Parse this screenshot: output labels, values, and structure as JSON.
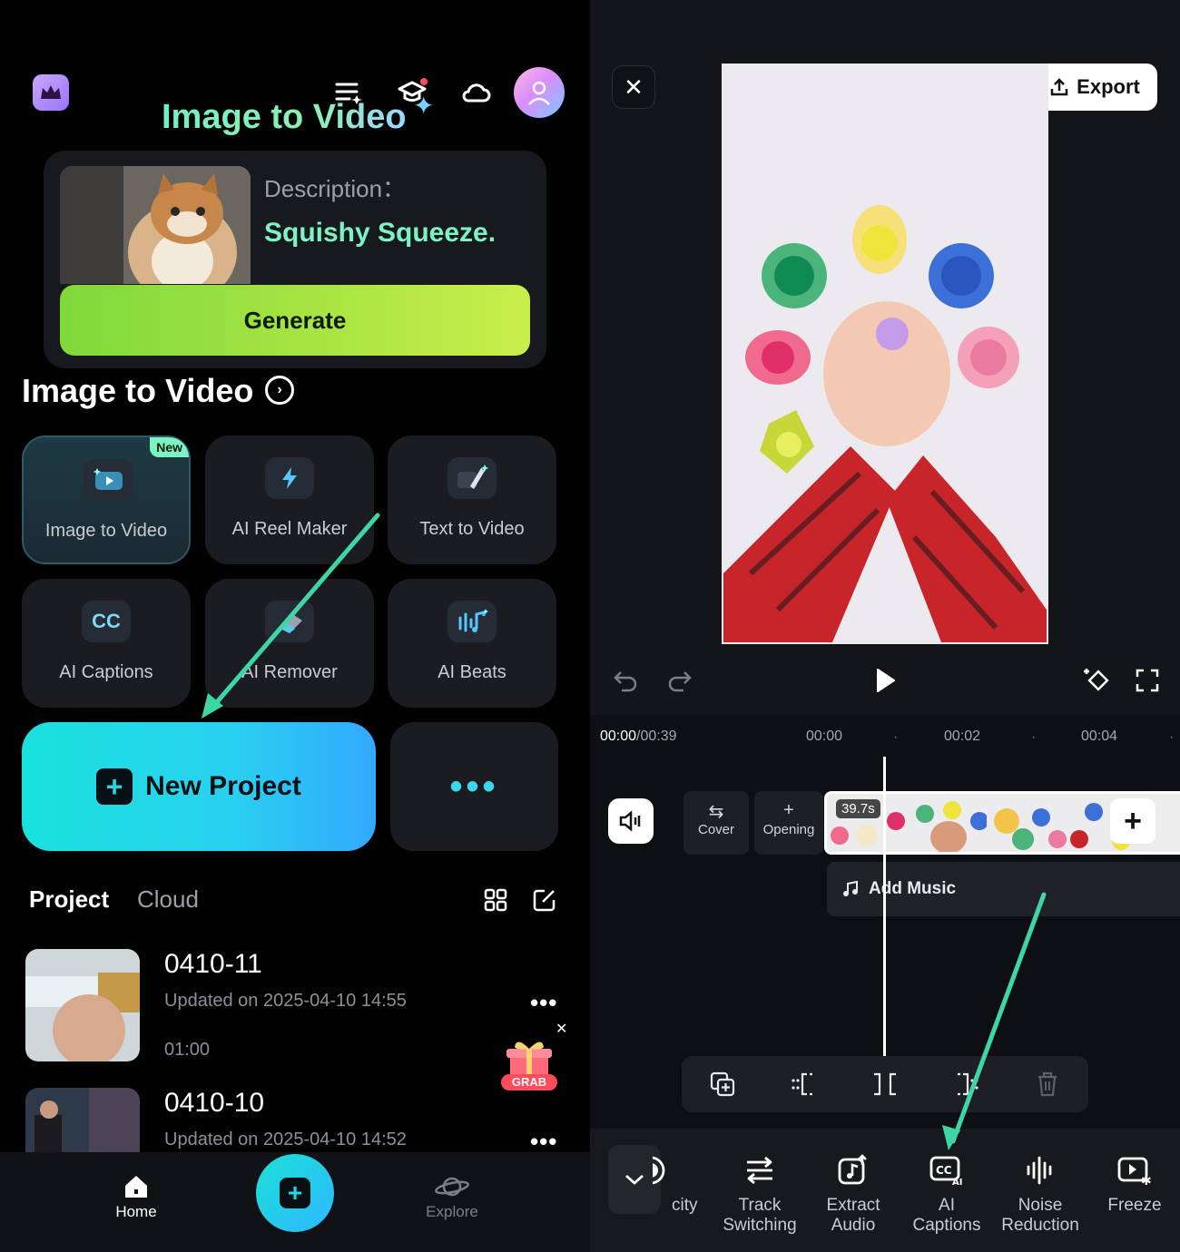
{
  "left": {
    "banner": {
      "title": "Image to Video",
      "description_label": "Description：",
      "description_text": "Squishy Squeeze.",
      "generate_label": "Generate"
    },
    "section_title": "Image to Video",
    "tools": [
      {
        "label": "Image to Video",
        "badge": "New"
      },
      {
        "label": "AI Reel Maker"
      },
      {
        "label": "Text to Video"
      },
      {
        "label": "AI Captions",
        "icon_text": "CC"
      },
      {
        "label": "AI Remover"
      },
      {
        "label": "AI Beats"
      }
    ],
    "new_project_label": "New Project",
    "more_label": "•••",
    "tabs": {
      "project": "Project",
      "cloud": "Cloud"
    },
    "projects": [
      {
        "title": "0410-11",
        "updated": "Updated on 2025-04-10 14:55",
        "duration": "01:00"
      },
      {
        "title": "0410-10",
        "updated": "Updated on 2025-04-10 14:52"
      }
    ],
    "gift_label": "GRAB",
    "bottom_nav": {
      "home": "Home",
      "explore": "Explore"
    }
  },
  "right": {
    "export_label": "Export",
    "timecode_current": "00:00",
    "timecode_total": "/00:39",
    "ruler": [
      "00:00",
      "00:02",
      "00:04"
    ],
    "chips": {
      "cover": "Cover",
      "opening": "Opening"
    },
    "clip_duration": "39.7s",
    "add_music_label": "Add Music",
    "toolbar": [
      {
        "label": "city"
      },
      {
        "label": "Track\nSwitching"
      },
      {
        "label": "Extract\nAudio"
      },
      {
        "label": "AI\nCaptions"
      },
      {
        "label": "Noise\nReduction"
      },
      {
        "label": "Freeze"
      }
    ]
  },
  "colors": {
    "accent_teal": "#2ad0f0",
    "accent_green": "#7df2c3",
    "generate_green": "#a4e33f",
    "annotation_arrow": "#3fd6a6"
  }
}
